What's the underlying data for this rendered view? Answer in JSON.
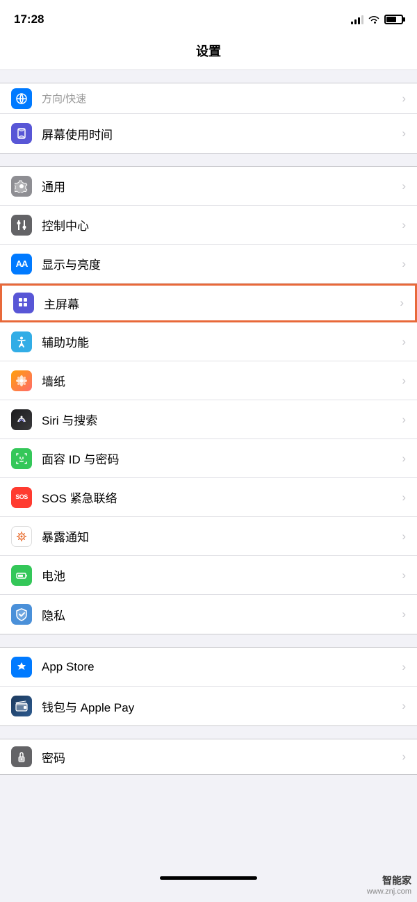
{
  "statusBar": {
    "time": "17:28",
    "locationArrow": "›",
    "signal": "signal",
    "wifi": "wifi",
    "battery": "battery"
  },
  "pageTitle": "设置",
  "groups": [
    {
      "id": "group1",
      "items": [
        {
          "id": "fanyi",
          "label": "方向/快速",
          "iconBg": "icon-blue",
          "iconType": "translate",
          "highlighted": false
        },
        {
          "id": "screentime",
          "label": "屏幕使用时间",
          "iconBg": "screentime-icon",
          "iconType": "hourglass",
          "highlighted": false
        }
      ]
    },
    {
      "id": "group2",
      "items": [
        {
          "id": "general",
          "label": "通用",
          "iconBg": "icon-gray",
          "iconType": "gear",
          "highlighted": false
        },
        {
          "id": "controlcenter",
          "label": "控制中心",
          "iconBg": "icon-gray2",
          "iconType": "sliders",
          "highlighted": false
        },
        {
          "id": "display",
          "label": "显示与亮度",
          "iconBg": "icon-blue",
          "iconType": "AA",
          "highlighted": false
        },
        {
          "id": "homescreen",
          "label": "主屏幕",
          "iconBg": "icon-grid",
          "iconType": "grid",
          "highlighted": true
        },
        {
          "id": "accessibility",
          "label": "辅助功能",
          "iconBg": "icon-teal",
          "iconType": "accessibility",
          "highlighted": false
        },
        {
          "id": "wallpaper",
          "label": "墙纸",
          "iconBg": "icon-multi",
          "iconType": "flower",
          "highlighted": false
        },
        {
          "id": "siri",
          "label": "Siri 与搜索",
          "iconBg": "icon-siri",
          "iconType": "siri",
          "highlighted": false
        },
        {
          "id": "faceid",
          "label": "面容 ID 与密码",
          "iconBg": "icon-faceid",
          "iconType": "faceid",
          "highlighted": false
        },
        {
          "id": "sos",
          "label": "SOS 紧急联络",
          "iconBg": "icon-sos",
          "iconType": "sos",
          "highlighted": false
        },
        {
          "id": "exposure",
          "label": "暴露通知",
          "iconBg": "icon-exposure",
          "iconType": "exposure",
          "highlighted": false
        },
        {
          "id": "battery",
          "label": "电池",
          "iconBg": "icon-battery",
          "iconType": "battery",
          "highlighted": false
        },
        {
          "id": "privacy",
          "label": "隐私",
          "iconBg": "icon-privacy",
          "iconType": "privacy",
          "highlighted": false
        }
      ]
    },
    {
      "id": "group3",
      "items": [
        {
          "id": "appstore",
          "label": "App Store",
          "iconBg": "icon-appstore",
          "iconType": "appstore",
          "highlighted": false
        },
        {
          "id": "wallet",
          "label": "钱包与 Apple Pay",
          "iconBg": "icon-wallet",
          "iconType": "wallet",
          "highlighted": false
        }
      ]
    },
    {
      "id": "group4",
      "items": [
        {
          "id": "password",
          "label": "密码",
          "iconBg": "icon-password",
          "iconType": "password",
          "highlighted": false
        }
      ]
    }
  ],
  "watermark": {
    "line1": "智能家",
    "line2": "www.znj.com"
  }
}
